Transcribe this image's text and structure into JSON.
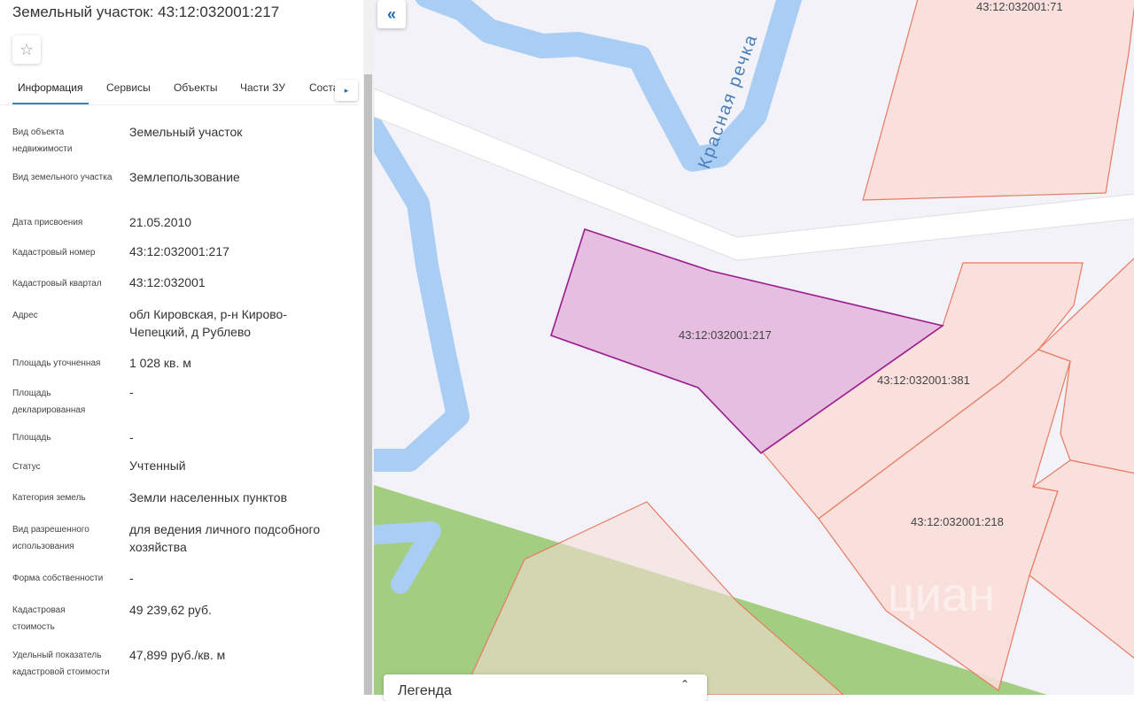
{
  "panel": {
    "title": "Земельный участок: 43:12:032001:217",
    "star_icon": "☆",
    "tabs": [
      {
        "label": "Информация"
      },
      {
        "label": "Сервисы"
      },
      {
        "label": "Объекты"
      },
      {
        "label": "Части ЗУ"
      },
      {
        "label": "Соста"
      }
    ],
    "tabs_scroll_icon": "▸",
    "fields": [
      {
        "label": "Вид объекта недвижимости",
        "value": "Земельный участок"
      },
      {
        "label": "Вид земельного участка",
        "value": "Землепользование"
      },
      {
        "label": "Дата присвоения",
        "value": "21.05.2010"
      },
      {
        "label": "Кадастровый номер",
        "value": "43:12:032001:217"
      },
      {
        "label": "Кадастровый квартал",
        "value": "43:12:032001"
      },
      {
        "label": "Адрес",
        "value": "обл Кировская, р-н Кирово-Чепецкий, д Рублево"
      },
      {
        "label": "Площадь уточненная",
        "value": "1 028 кв. м"
      },
      {
        "label": "Площадь декларированная",
        "value": "-"
      },
      {
        "label": "Площадь",
        "value": "-"
      },
      {
        "label": "Статус",
        "value": "Учтенный"
      },
      {
        "label": "Категория земель",
        "value": "Земли населенных пунктов"
      },
      {
        "label": "Вид разрешенного использования",
        "value": "для ведения личного подсобного хозяйства"
      },
      {
        "label": "Форма собственности",
        "value": "-"
      },
      {
        "label": "Кадастровая стоимость",
        "value": "49 239,62 руб."
      },
      {
        "label": "Удельный показатель кадастровой стоимости",
        "value": "47,899 руб./кв. м"
      }
    ]
  },
  "map": {
    "collapse_icon": "«",
    "river_label": "Красная речка",
    "parcels": [
      {
        "id": "43:12:032001:217"
      },
      {
        "id": "43:12:032001:381"
      },
      {
        "id": "43:12:032001:218"
      },
      {
        "id": "43:12:032001:71"
      }
    ],
    "watermark": "циан",
    "legend": {
      "title": "Легенда",
      "toggle_icon": "⌃"
    },
    "colors": {
      "selected_fill": "#e3b5dc",
      "selected_stroke": "#9b1c8e",
      "parcel_fill": "#f9ded8",
      "parcel_stroke": "#e87a62",
      "river": "#a9cdf3",
      "green_zone": "#a3cd80",
      "road": "#ffffff"
    }
  }
}
